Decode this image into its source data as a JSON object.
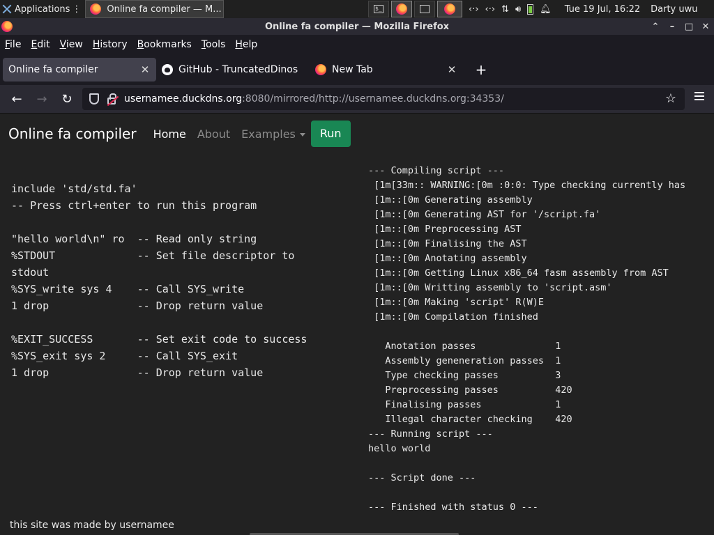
{
  "os_panel": {
    "applications_label": "Applications",
    "applications_suffix": "⋮",
    "task_label": "Online fa compiler — M...",
    "clock": "Tue 19 Jul, 16:22",
    "user": "Darty uwu",
    "tray_icons": [
      "network-icon",
      "network-icon",
      "transfer-icon",
      "volume-icon",
      "battery-icon",
      "notifications-icon"
    ],
    "workspace_icons": [
      "terminal-icon",
      "firefox-icon",
      "window-icon",
      "firefox-icon"
    ]
  },
  "window": {
    "title": "Online fa compiler — Mozilla Firefox",
    "controls": [
      "⌃",
      "–",
      "□",
      "✕"
    ]
  },
  "menubar": [
    "File",
    "Edit",
    "View",
    "History",
    "Bookmarks",
    "Tools",
    "Help"
  ],
  "tabs": [
    {
      "label": "Online fa compiler",
      "icon": "none",
      "active": true
    },
    {
      "label": "GitHub - TruncatedDinos",
      "icon": "github-icon",
      "active": false
    },
    {
      "label": "New Tab",
      "icon": "firefox-icon",
      "active": false
    }
  ],
  "new_tab_label": "+",
  "url": {
    "host": "usernamee.duckdns.org",
    "rest": ":8080/mirrored/http://usernamee.duckdns.org:34353/"
  },
  "site": {
    "brand": "Online fa compiler",
    "nav": [
      "Home",
      "About",
      "Examples"
    ],
    "run_label": "Run",
    "footer": "this site was made by usernamee",
    "accent": "#198754"
  },
  "editor_lines": [
    "include 'std/std.fa'",
    "-- Press ctrl+enter to run this program",
    "",
    "\"hello world\\n\" ro  -- Read only string",
    "%STDOUT             -- Set file descriptor to",
    "stdout",
    "%SYS_write sys 4    -- Call SYS_write",
    "1 drop              -- Drop return value",
    "",
    "%EXIT_SUCCESS       -- Set exit code to success",
    "%SYS_exit sys 2     -- Call SYS_exit",
    "1 drop              -- Drop return value"
  ],
  "output_lines": [
    "--- Compiling script ---",
    " [1m[33m:: WARNING:[0m :0:0: Type checking currently has",
    " [1m::[0m Generating assembly",
    " [1m::[0m Generating AST for '/script.fa'",
    " [1m::[0m Preprocessing AST",
    " [1m::[0m Finalising the AST",
    " [1m::[0m Anotating assembly",
    " [1m::[0m Getting Linux x86_64 fasm assembly from AST",
    " [1m::[0m Writting assembly to 'script.asm'",
    " [1m::[0m Making 'script' R(W)E",
    " [1m::[0m Compilation finished",
    "",
    "   Anotation passes              1",
    "   Assembly geneneration passes  1",
    "   Type checking passes          3",
    "   Preprocessing passes          420",
    "   Finalising passes             1",
    "   Illegal character checking    420",
    "--- Running script ---",
    "hello world",
    "",
    "--- Script done ---",
    "",
    "--- Finished with status 0 ---"
  ]
}
